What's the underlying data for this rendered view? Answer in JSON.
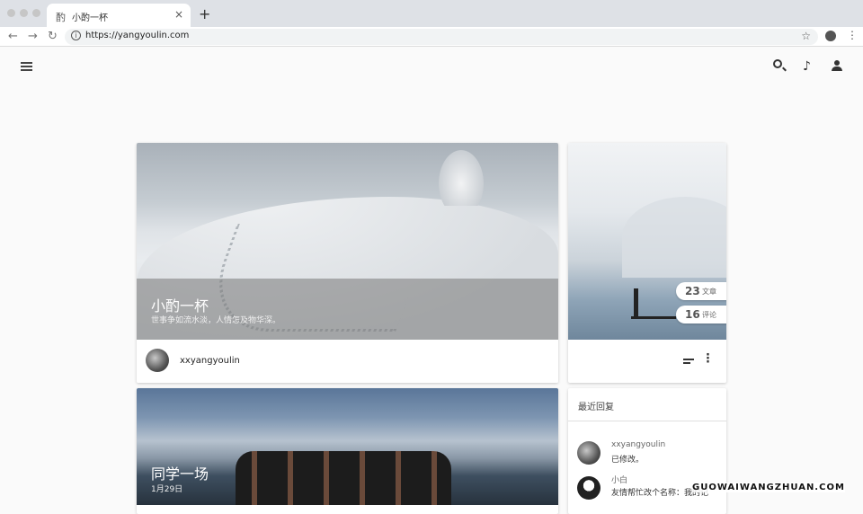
{
  "browser": {
    "tab_title": "小酌一杯",
    "tab_favicon": "酌",
    "url": "https://yangyoulin.com",
    "icons": [
      "back-icon",
      "forward-icon",
      "reload-icon",
      "info-icon",
      "star-icon",
      "account-icon",
      "more-icon"
    ]
  },
  "toolbar": {
    "icons": [
      "menu-icon",
      "search-icon",
      "music-icon",
      "person-icon"
    ]
  },
  "hero": {
    "title": "小酌一杯",
    "subtitle": "世事争如流水淡，人情怎及物华深。",
    "author": "xxyangyoulin"
  },
  "stats": {
    "posts_count": "23",
    "posts_label": "文章",
    "comments_count": "16",
    "comments_label": "评论"
  },
  "recent": {
    "title": "最近回复",
    "items": [
      {
        "name": "xxyangyoulin",
        "text": "已修改。"
      },
      {
        "name": "小白",
        "text": "友情帮忙改个名称：我的记"
      }
    ]
  },
  "post": {
    "title": "同学一场",
    "date": "1月29日"
  },
  "watermark": "GUOWAIWANGZHUAN.COM"
}
